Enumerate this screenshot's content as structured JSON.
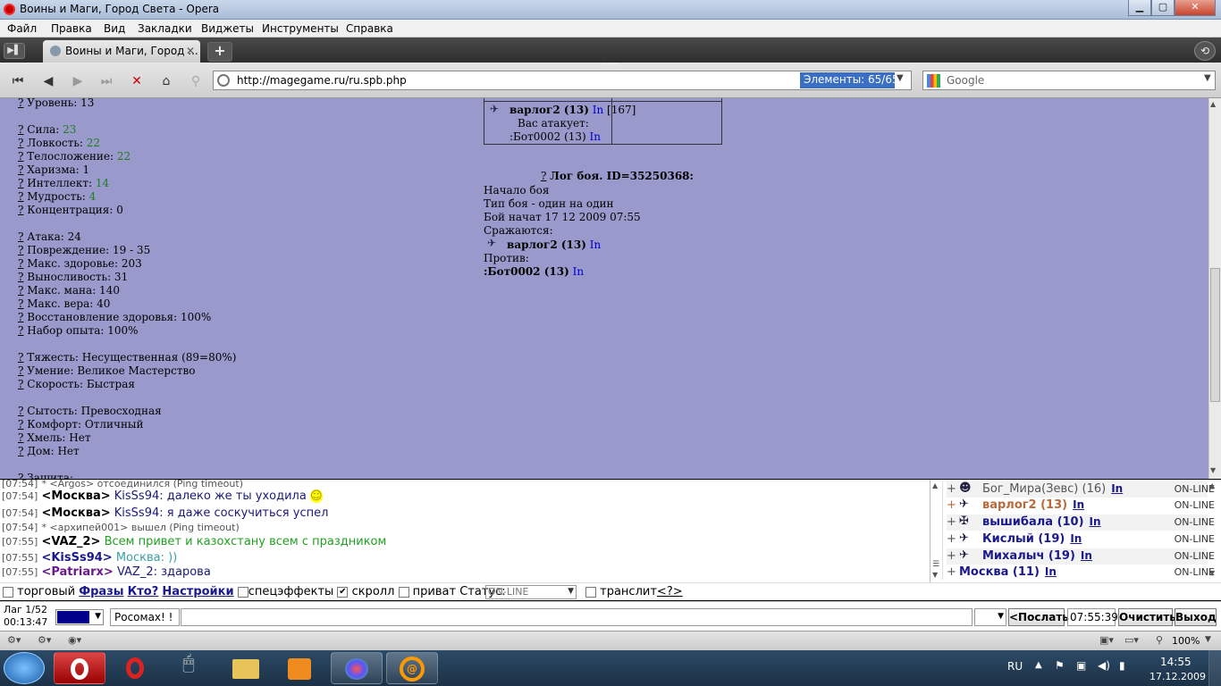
{
  "window": {
    "title": "Воины и Маги, Город Света - Opera",
    "minimize": "▁",
    "maximize": "▢",
    "close": "✕"
  },
  "menu": [
    "Файл",
    "Правка",
    "Вид",
    "Закладки",
    "Виджеты",
    "Инструменты",
    "Справка"
  ],
  "tab": {
    "title": "Воины и Маги, Город ...",
    "close": "✕",
    "new": "+"
  },
  "nav": {
    "url": "http://magegame.ru/ru.spb.php",
    "elements": "Элементы:   65/65",
    "search_placeholder": "Google"
  },
  "content": {
    "level": "Уровень: 13",
    "stats": [
      {
        "label": "Сила: ",
        "value": "23",
        "green": true
      },
      {
        "label": "Ловкость: ",
        "value": "22",
        "green": true
      },
      {
        "label": "Телосложение: ",
        "value": "22",
        "green": true
      },
      {
        "label": "Харизма: ",
        "value": "1",
        "green": false
      },
      {
        "label": "Интеллект: ",
        "value": "14",
        "green": true
      },
      {
        "label": "Мудрость: ",
        "value": "4",
        "green": true
      },
      {
        "label": "Концентрация: ",
        "value": "0",
        "green": false
      }
    ],
    "combat": [
      "Атака: 24",
      "Повреждение: 19 - 35",
      "Макс. здоровье: 203",
      "Выносливость: 31",
      "Макс. мана: 140",
      "Макс. вера: 40",
      "Восстановление здоровья: 100%",
      "Набор опыта: 100%"
    ],
    "load": [
      "Тяжесть: Несущественная (89=80%)",
      "Умение: Великое Мастерство",
      "Скорость: Быстрая"
    ],
    "state": [
      "Сытость: Превосходная",
      "Комфорт: Отличный",
      "Хмель: Нет",
      "Дом: Нет"
    ],
    "cut": "Защита:",
    "q": "?",
    "battle_box": {
      "player": "варлог2 (13)",
      "in": "In",
      "hp": "[167]",
      "attacked": "Вас атакует:",
      "enemy": ":Бот0002 (13)"
    },
    "log": {
      "title": "Лог боя. ID=35250368:",
      "l1": "Начало боя",
      "l2": "Тип боя - один на один",
      "l3": "Бой начат 17 12 2009 07:55",
      "l4": "Сражаются:",
      "p1": "варлог2 (13)",
      "vs": "Против:",
      "p2": ":Бот0002 (13)",
      "in": "In"
    }
  },
  "chat": [
    {
      "t": "[07:54]",
      "nick": "* <Argos>",
      "msg": " отсоединился (Ping timeout)",
      "type": "sys"
    },
    {
      "t": "[07:54]",
      "nick": "<Москва>",
      "msg": " KisSs94: далеко же ты уходила ",
      "type": "msg",
      "nickColor": "#000",
      "msgColor": "#1a1a7a",
      "smiley": "☺"
    },
    {
      "t": "[07:54]",
      "nick": "<Москва>",
      "msg": " KisSs94: я даже соскучиться успел",
      "type": "msg",
      "nickColor": "#000",
      "msgColor": "#1a1a7a"
    },
    {
      "t": "[07:54]",
      "nick": "* <архипей001>",
      "msg": " вышел (Ping timeout)",
      "type": "sys"
    },
    {
      "t": "[07:55]",
      "nick": "<VAZ_2>",
      "msg": " Всем привет и казохстану всем с праздником",
      "type": "msg",
      "nickColor": "#000",
      "msgColor": "#20a020"
    },
    {
      "t": "[07:55]",
      "nick": "<KisSs94>",
      "msg": " Москва: ))",
      "type": "msg",
      "nickColor": "#1a1a8c",
      "msgColor": "#3aa0a0"
    },
    {
      "t": "[07:55]",
      "nick": "<Patriarx>",
      "msg": " VAZ_2: здарова",
      "type": "msg",
      "nickColor": "#6a1a8a",
      "msgColor": "#1a1a7a"
    }
  ],
  "users": [
    {
      "name": "Бог_Мира(Зевс) (16)",
      "in": "In",
      "status": "ON-LINE",
      "color": "#555",
      "bold": false
    },
    {
      "name": "варлог2 (13)",
      "in": "In",
      "status": "ON-LINE",
      "color": "#b86a3a",
      "bold": true
    },
    {
      "name": "вышибала (10)",
      "in": "In",
      "status": "ON-LINE",
      "color": "#1a1a8c",
      "bold": true
    },
    {
      "name": "Кислый (19)",
      "in": "In",
      "status": "ON-LINE",
      "color": "#1a1a8c",
      "bold": true
    },
    {
      "name": "Михалыч (19)",
      "in": "In",
      "status": "ON-LINE",
      "color": "#1a1a8c",
      "bold": true
    },
    {
      "name": "Москва (11)",
      "in": "In",
      "status": "ON-LINE",
      "color": "#1a1a8c",
      "bold": true
    }
  ],
  "controls": {
    "trade": "торговый",
    "phrases": "Фразы",
    "who": "Кто?",
    "settings": "Настройки",
    "effects": "спецэффекты",
    "scroll": "скролл",
    "private": "приват",
    "status_label": "Статус:",
    "status_value": "ON-LINE",
    "translit": "транслит",
    "translit_help": "<?>"
  },
  "input": {
    "lag": "Лаг 1/52",
    "timer": "00:13:47",
    "recipient": "Росомах! !",
    "message": "",
    "send": "<Послать",
    "time": "07:55:39",
    "clear": "Очистить",
    "exit": "Выход"
  },
  "statusbar": {
    "zoom": "100%"
  },
  "taskbar": {
    "lang": "RU",
    "time": "14:55",
    "date": "17.12.2009"
  }
}
